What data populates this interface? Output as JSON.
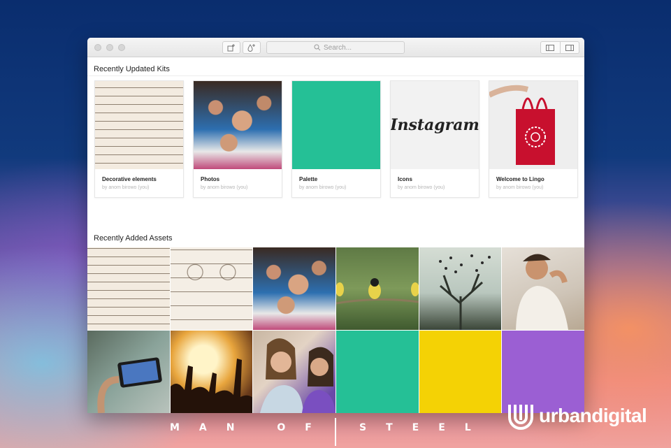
{
  "toolbar": {
    "search_placeholder": "Search...",
    "add_kit_icon": "add-window-icon",
    "add_color_icon": "add-drop-icon",
    "sidebar_left_icon": "sidebar-left-icon",
    "sidebar_right_icon": "sidebar-right-icon"
  },
  "sections": {
    "kits_title": "Recently Updated Kits",
    "assets_title": "Recently Added Assets"
  },
  "kits": [
    {
      "name": "Decorative elements",
      "by": "by anom birowo (you)",
      "thumb": "ornament"
    },
    {
      "name": "Photos",
      "by": "by anom birowo (you)",
      "thumb": "crowd"
    },
    {
      "name": "Palette",
      "by": "by anom birowo (you)",
      "thumb": "green",
      "color": "#25c096"
    },
    {
      "name": "Icons",
      "by": "by anom birowo (you)",
      "thumb": "instagram",
      "thumb_text": "Instagram"
    },
    {
      "name": "Welcome to Lingo",
      "by": "by anom birowo (you)",
      "thumb": "bag"
    }
  ],
  "assets": [
    {
      "kind": "ornament"
    },
    {
      "kind": "ornament2"
    },
    {
      "kind": "crowd"
    },
    {
      "kind": "birds"
    },
    {
      "kind": "flock"
    },
    {
      "kind": "shout"
    },
    {
      "kind": "phone"
    },
    {
      "kind": "concert"
    },
    {
      "kind": "girls"
    },
    {
      "kind": "color",
      "color": "#25c096"
    },
    {
      "kind": "color",
      "color": "#f4d205"
    },
    {
      "kind": "color",
      "color": "#9b5fd3"
    }
  ],
  "footer": {
    "left": "MAN OF",
    "right": "STEEL"
  },
  "brand": {
    "name": "urbandigital",
    "logo_icon": "urbandigital-logo-icon"
  }
}
